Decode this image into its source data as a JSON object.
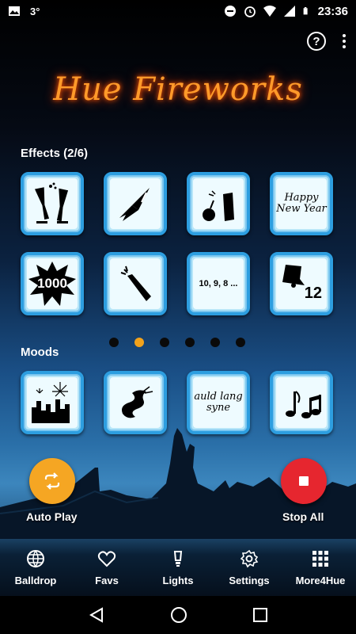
{
  "status_bar": {
    "temperature": "3°",
    "time": "23:36"
  },
  "app": {
    "title": "Hue Fireworks"
  },
  "effects": {
    "label": "Effects (2/6)",
    "tiles": [
      {
        "name": "champagne-glasses",
        "text": ""
      },
      {
        "name": "rocket",
        "text": ""
      },
      {
        "name": "firecracker-bomb",
        "text": ""
      },
      {
        "name": "happy-new-year",
        "text": "Happy New Year"
      },
      {
        "name": "1000-burst",
        "text": "1000"
      },
      {
        "name": "champagne-bottle",
        "text": ""
      },
      {
        "name": "countdown",
        "text": "10, 9, 8 ..."
      },
      {
        "name": "bell-12",
        "text": "12"
      }
    ],
    "page_count": 6,
    "active_page": 2
  },
  "moods": {
    "label": "Moods",
    "tiles": [
      {
        "name": "city-fireworks",
        "text": ""
      },
      {
        "name": "dragon",
        "text": ""
      },
      {
        "name": "auld-lang-syne",
        "text": "auld lang syne"
      },
      {
        "name": "music-notes",
        "text": ""
      }
    ]
  },
  "actions": {
    "auto_play": "Auto Play",
    "stop_all": "Stop All"
  },
  "nav": {
    "items": [
      {
        "label": "Balldrop",
        "icon": "globe-icon"
      },
      {
        "label": "Favs",
        "icon": "heart-icon"
      },
      {
        "label": "Lights",
        "icon": "bulb-icon"
      },
      {
        "label": "Settings",
        "icon": "gear-icon"
      },
      {
        "label": "More4Hue",
        "icon": "grid-icon"
      }
    ]
  },
  "colors": {
    "accent_orange": "#f5a623",
    "stop_red": "#e6262f",
    "tile_border": "#2d9ee0"
  }
}
